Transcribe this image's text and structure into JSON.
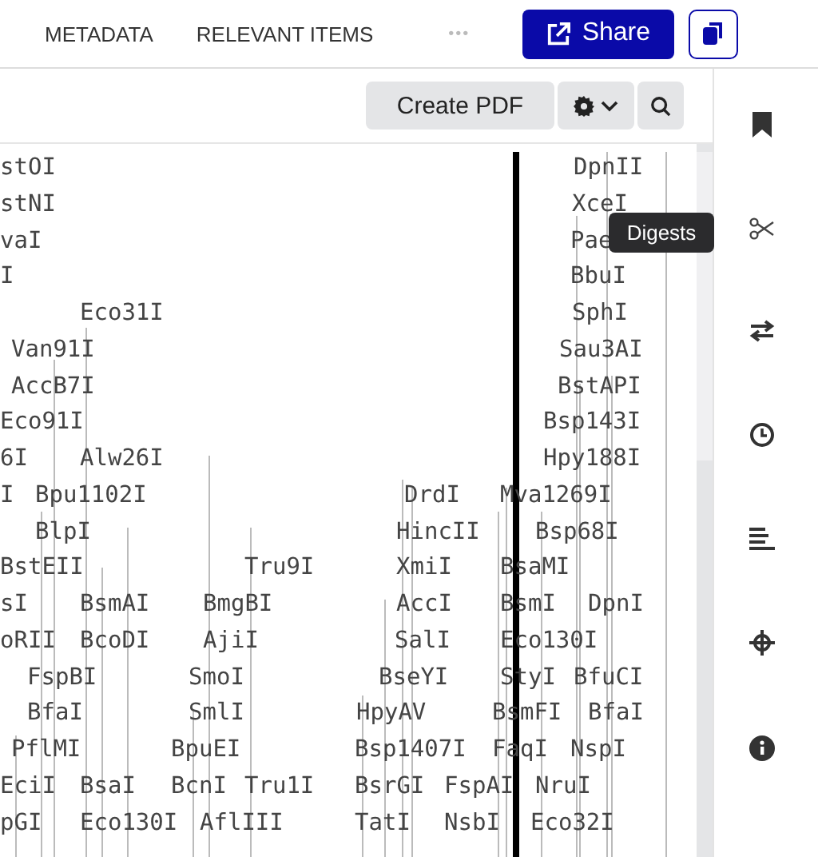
{
  "tabs": [
    {
      "label": "METADATA"
    },
    {
      "label": "RELEVANT ITEMS"
    }
  ],
  "more": "•••",
  "share_button": "Share",
  "toolbar": {
    "create_pdf": "Create PDF"
  },
  "enzyme_rows": [
    [
      "stOI",
      "DpnII"
    ],
    [
      "stNI",
      "XceI"
    ],
    [
      "vaI",
      "Pae"
    ],
    [
      "I",
      "BbuI"
    ],
    [
      "Eco31I",
      "SphI"
    ],
    [
      "Van91I",
      "Sau3AI"
    ],
    [
      "AccB7I",
      "BstAPI"
    ],
    [
      "Eco91I",
      "Bsp143I"
    ],
    [
      "6I",
      "Alw26I",
      "Hpy188I"
    ],
    [
      "I",
      "Bpu1102I",
      "DrdI",
      "Mva1269I"
    ],
    [
      "BlpI",
      "HincII",
      "Bsp68I"
    ],
    [
      "BstEII",
      "Tru9I",
      "XmiI",
      "BsaMI"
    ],
    [
      "sI",
      "BsmAI",
      "BmgBI",
      "AccI",
      "BsmI",
      "DpnI"
    ],
    [
      "oRII",
      "BcoDI",
      "AjiI",
      "SalI",
      "Eco130I"
    ],
    [
      "FspBI",
      "SmoI",
      "BseYI",
      "StyI",
      "BfuCI"
    ],
    [
      "BfaI",
      "SmlI",
      "HpyAV",
      "BsmFI",
      "BfaI"
    ],
    [
      "PflMI",
      "BpuEI",
      "Bsp1407I",
      "FaqI",
      "NspI"
    ],
    [
      "EciI",
      "BsaI",
      "BcnI",
      "Tru1I",
      "BsrGI",
      "FspAI",
      "NruI"
    ],
    [
      "pGI",
      "Eco130I",
      "AflIII",
      "TatI",
      "NsbI",
      "Eco32I"
    ]
  ],
  "tooltip": "Digests"
}
